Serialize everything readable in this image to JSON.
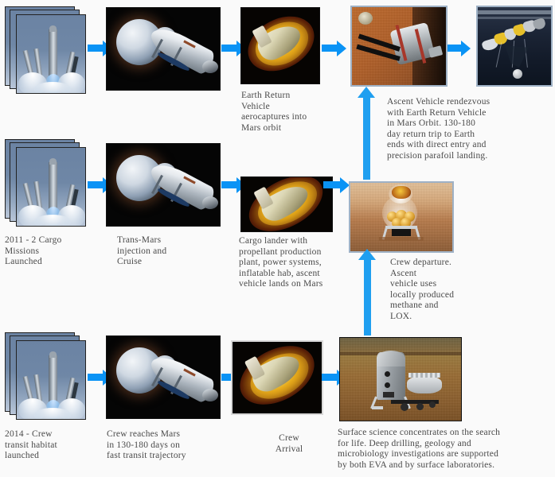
{
  "diagram": {
    "title": "Mars Mission Architecture Flow",
    "background_color": "#fafafa",
    "arrow_color": "#0a93f5",
    "text_color": "#4a4a4a"
  },
  "rows": {
    "row1": {
      "node1": {
        "name": "cargo-launch-stack",
        "icon": "rocket-launch-photo-stack",
        "caption": ""
      },
      "node2": {
        "name": "trans-mars-injection",
        "icon": "spacecraft-earth-departure",
        "caption": ""
      },
      "node3": {
        "name": "earth-return-vehicle-aerocapture",
        "icon": "aerocapture-fireball",
        "caption": "Earth Return\nVehicle\naerocaptures into\nMars orbit"
      },
      "node4": {
        "name": "mars-orbit-rendezvous",
        "icon": "orbiting-vehicle-over-mars",
        "caption": ""
      },
      "node5": {
        "name": "earth-parafoil-landing",
        "icon": "parafoil-descent",
        "caption": ""
      },
      "side_caption": "Ascent Vehicle rendezvous\nwith Earth Return Vehicle\nin Mars Orbit.  130-180\nday return trip to Earth\nends with direct entry and\nprecision parafoil landing."
    },
    "row2": {
      "node1": {
        "name": "cargo-missions-launch",
        "icon": "rocket-launch-photo-stack",
        "caption": "2011 - 2 Cargo\nMissions\nLaunched"
      },
      "node2": {
        "name": "trans-mars-injection-cruise",
        "icon": "spacecraft-earth-departure",
        "caption": "Trans-Mars\ninjection and\nCruise"
      },
      "node3": {
        "name": "cargo-lander-aeroentry",
        "icon": "aerocapture-fireball",
        "caption": "Cargo lander with\npropellant production\nplant, power systems,\ninflatable hab, ascent\nvehicle lands on Mars"
      },
      "node4": {
        "name": "ascent-vehicle-liftoff",
        "icon": "mars-ascent-vehicle-launch",
        "caption": "Crew departure.\nAscent\nvehicle uses\nlocally produced\nmethane and\nLOX."
      }
    },
    "row3": {
      "node1": {
        "name": "crew-habitat-launch",
        "icon": "rocket-launch-photo-stack",
        "caption": "2014 - Crew\ntransit habitat\nlaunched"
      },
      "node2": {
        "name": "crew-transit-cruise",
        "icon": "spacecraft-earth-departure",
        "caption": "Crew reaches Mars\nin 130-180 days on\nfast transit trajectory"
      },
      "node3": {
        "name": "crew-arrival-aeroentry",
        "icon": "aerocapture-fireball",
        "caption": "Crew\nArrival"
      },
      "node4": {
        "name": "mars-surface-operations",
        "icon": "mars-surface-base-and-rover",
        "caption": "Surface science concentrates on the search\nfor life.  Deep drilling, geology and\nmicrobiology investigations are supported\n by both EVA and by surface laboratories."
      }
    }
  },
  "arrows": {
    "r1a": {
      "name": "arrow-launch-to-cruise-row1",
      "direction": "right"
    },
    "r1b": {
      "name": "arrow-cruise-to-aerocapture-row1",
      "direction": "right"
    },
    "r1c": {
      "name": "arrow-aerocapture-to-orbit-row1",
      "direction": "right"
    },
    "r1d": {
      "name": "arrow-orbit-to-parafoil-row1",
      "direction": "right"
    },
    "r2a": {
      "name": "arrow-launch-to-cruise-row2",
      "direction": "right"
    },
    "r2b": {
      "name": "arrow-cruise-to-aerocapture-row2",
      "direction": "right"
    },
    "r2c": {
      "name": "arrow-aerocapture-to-lander-row2",
      "direction": "right"
    },
    "r3a": {
      "name": "arrow-launch-to-cruise-row3",
      "direction": "right"
    },
    "r3b": {
      "name": "arrow-cruise-to-aerocapture-row3",
      "direction": "right"
    },
    "r3c": {
      "name": "arrow-aerocapture-to-surface-row3",
      "direction": "right"
    },
    "up1": {
      "name": "arrow-ascent-to-orbit",
      "direction": "up"
    },
    "up2": {
      "name": "arrow-surface-to-ascent",
      "direction": "up"
    }
  }
}
